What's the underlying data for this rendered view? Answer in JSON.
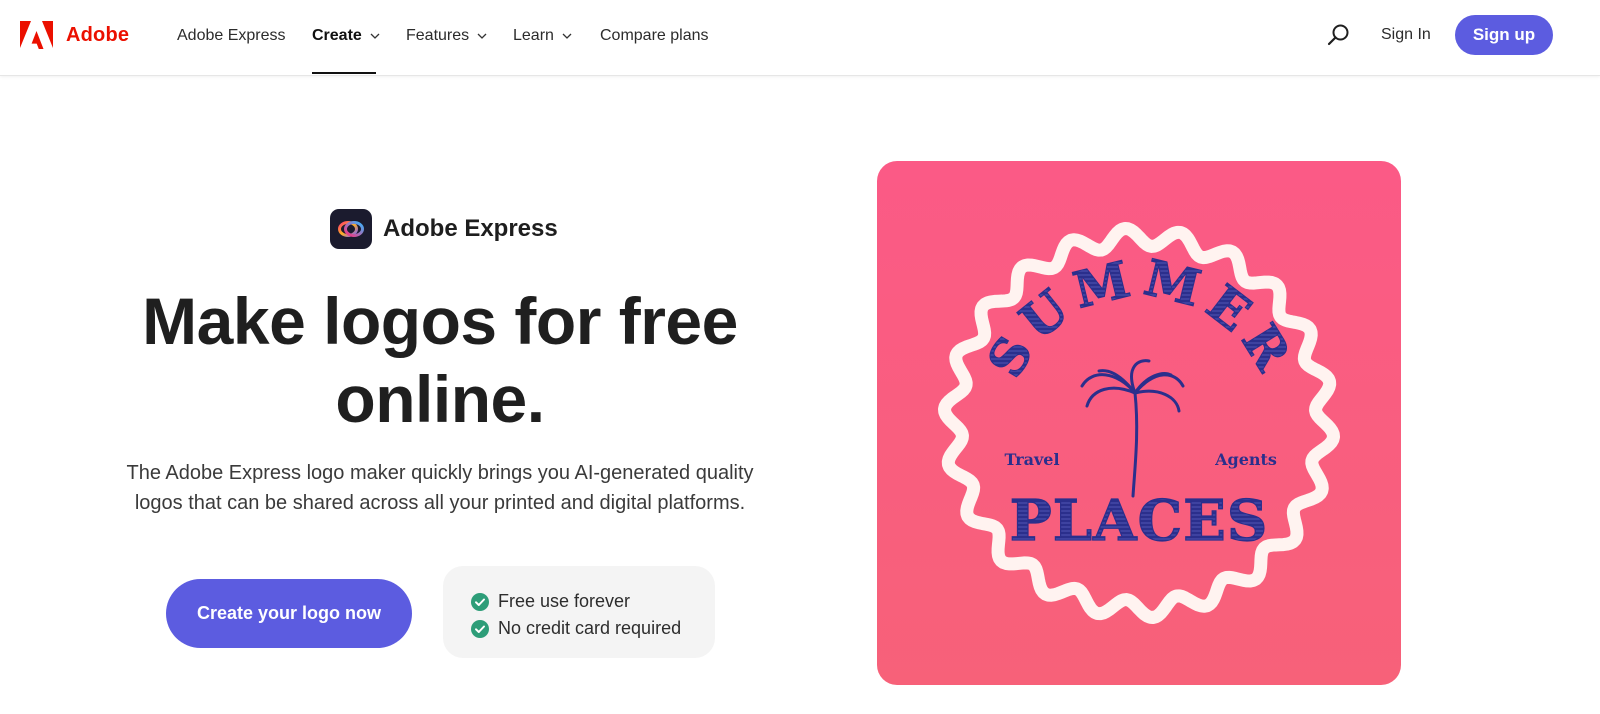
{
  "nav": {
    "brand": "Adobe",
    "items": [
      {
        "label": "Adobe Express",
        "dropdown": false,
        "active": false
      },
      {
        "label": "Create",
        "dropdown": true,
        "active": true
      },
      {
        "label": "Features",
        "dropdown": true,
        "active": false
      },
      {
        "label": "Learn",
        "dropdown": true,
        "active": false
      },
      {
        "label": "Compare plans",
        "dropdown": false,
        "active": false
      }
    ],
    "search_icon": "search-icon",
    "sign_in": "Sign In",
    "sign_up": "Sign up"
  },
  "hero": {
    "product_name": "Adobe Express",
    "headline_line1": "Make logos for free",
    "headline_line2": "online.",
    "subtext_line1": "The Adobe Express logo maker quickly brings you AI-generated quality",
    "subtext_line2": "logos that can be shared across all your printed and digital platforms.",
    "cta": "Create your logo now",
    "perks": [
      "Free use forever",
      "No credit card required"
    ]
  },
  "logo_sample": {
    "arc_text": "SUMMER",
    "left_word": "Travel",
    "right_word": "Agents",
    "bottom_word": "PLACES"
  },
  "colors": {
    "adobe_red": "#eb1000",
    "accent": "#5c5ce0",
    "check_green": "#2d9d78",
    "card_pink": "#fb5a86",
    "logo_navy": "#2b2f8c"
  }
}
